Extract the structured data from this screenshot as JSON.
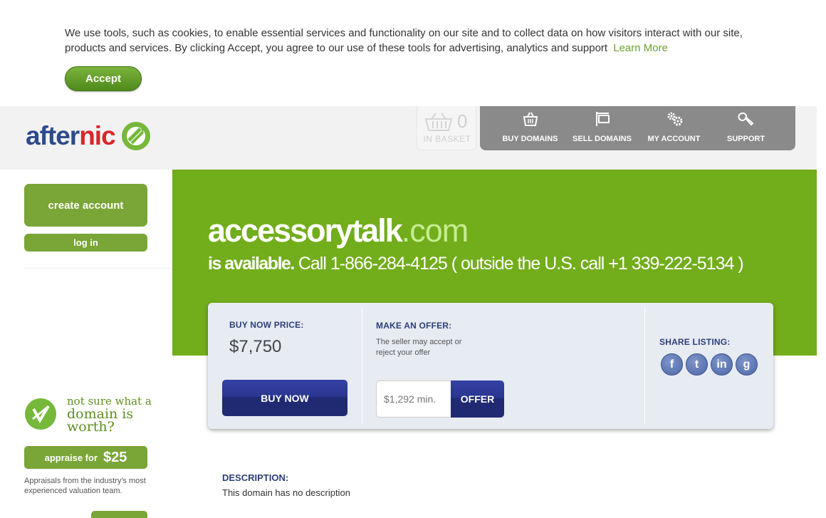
{
  "cookie": {
    "text": "We use tools, such as cookies, to enable essential services and functionality on our site and to collect data on how visitors interact with our site, products and services. By clicking Accept, you agree to our use of these tools for advertising, analytics and support",
    "learn_more": "Learn More",
    "accept": "Accept"
  },
  "header": {
    "logo_part1": "after",
    "logo_part2": "nic",
    "basket": {
      "count": "0",
      "label": "IN BASKET"
    },
    "nav": [
      {
        "label": "BUY DOMAINS",
        "icon": "basket-icon"
      },
      {
        "label": "SELL DOMAINS",
        "icon": "sign-icon"
      },
      {
        "label": "MY ACCOUNT",
        "icon": "gears-icon"
      },
      {
        "label": "SUPPORT",
        "icon": "wrench-icon"
      }
    ]
  },
  "sidebar": {
    "create_account": "create account",
    "log_in": "log in",
    "appraise": {
      "line1": "not sure what a",
      "line2": "domain is",
      "line3": "worth?",
      "button_prefix": "appraise for",
      "button_price": "$25",
      "note": "Appraisals from the industry's most experienced valuation team."
    }
  },
  "listing": {
    "name": "accessorytalk",
    "tld": ".com",
    "available": "is available.",
    "call": "Call 1-866-284-4125 ( outside the U.S. call +1 339-222-5134 )",
    "buy_label": "BUY NOW PRICE:",
    "price": "$7,750",
    "buy_button": "BUY NOW",
    "offer_label": "MAKE AN OFFER:",
    "offer_note": "The seller may accept or reject your offer",
    "offer_placeholder": "$1,292 min.",
    "offer_button": "OFFER",
    "share_label": "SHARE LISTING:",
    "share": [
      {
        "glyph": "f",
        "icon": "facebook-icon"
      },
      {
        "glyph": "t",
        "icon": "twitter-icon"
      },
      {
        "glyph": "in",
        "icon": "linkedin-icon"
      },
      {
        "glyph": "g",
        "icon": "google-icon"
      }
    ],
    "description_label": "DESCRIPTION:",
    "description": "This domain has no description"
  },
  "colors": {
    "brand_green": "#72ad1b",
    "button_green": "#7aa537",
    "navy": "#2c3f7a",
    "nav_gray": "#8a8a8a"
  }
}
